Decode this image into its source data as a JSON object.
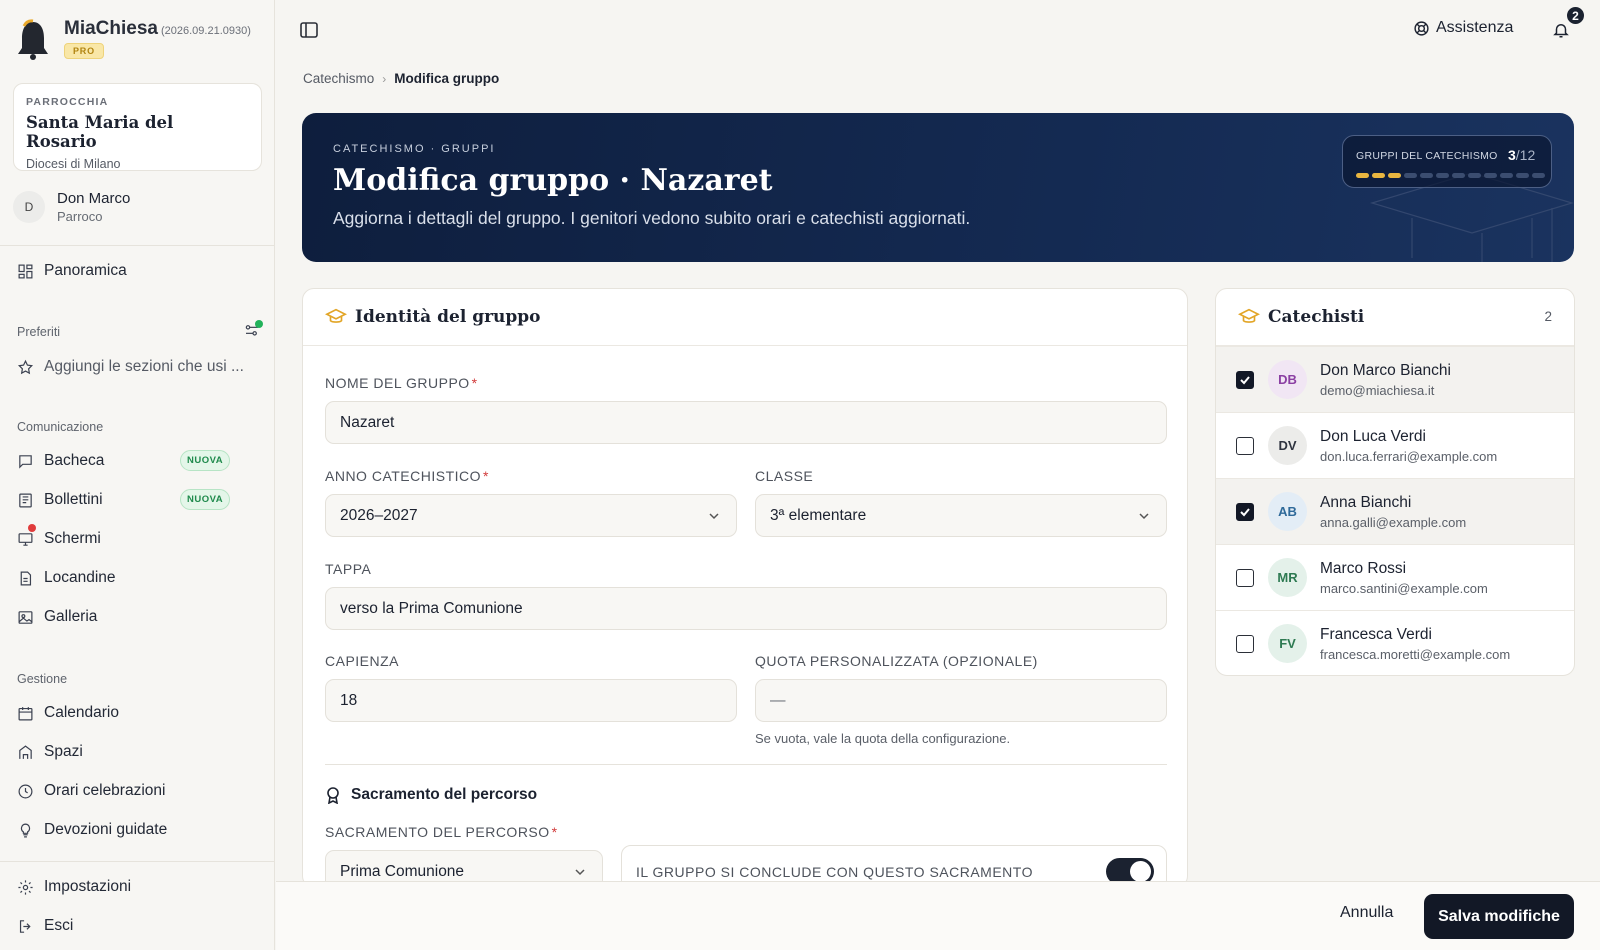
{
  "brand": {
    "name": "MiaChiesa",
    "version": "(2026.09.21.0930)",
    "badge": "PRO"
  },
  "parish": {
    "kicker": "PARROCCHIA",
    "name": "Santa Maria del Rosario",
    "diocese": "Diocesi di Milano"
  },
  "user": {
    "initial": "D",
    "name": "Don Marco",
    "role": "Parroco"
  },
  "sidebar": {
    "overview": "Panoramica",
    "favorites_title": "Preferiti",
    "favorites_add": "Aggiungi le sezioni che usi ...",
    "communication_title": "Comunicazione",
    "communication": [
      {
        "label": "Bacheca",
        "badge": "NUOVA"
      },
      {
        "label": "Bollettini",
        "badge": "NUOVA"
      },
      {
        "label": "Schermi"
      },
      {
        "label": "Locandine"
      },
      {
        "label": "Galleria"
      }
    ],
    "management_title": "Gestione",
    "management": [
      {
        "label": "Calendario"
      },
      {
        "label": "Spazi"
      },
      {
        "label": "Orari celebrazioni"
      },
      {
        "label": "Devozioni guidate"
      }
    ],
    "settings": "Impostazioni",
    "logout": "Esci"
  },
  "topbar": {
    "assist": "Assistenza",
    "notifications": "2"
  },
  "breadcrumb": {
    "parent": "Catechismo",
    "current": "Modifica gruppo"
  },
  "hero": {
    "kicker": "CATECHISMO · GRUPPI",
    "title": "Modifica gruppo · Nazaret",
    "subtitle": "Aggiorna i dettagli del gruppo. I genitori vedono subito orari e catechisti aggiornati.",
    "pill_label": "GRUPPI DEL CATECHISMO",
    "pill_current": "3",
    "pill_total": "/12",
    "progress": {
      "current": 3,
      "total": 12
    }
  },
  "form": {
    "title": "Identità del gruppo",
    "name_label": "NOME DEL GRUPPO",
    "name_value": "Nazaret",
    "year_label": "ANNO CATECHISTICO",
    "year_value": "2026–2027",
    "class_label": "CLASSE",
    "class_value": "3ª elementare",
    "stage_label": "TAPPA",
    "stage_value": "verso la Prima Comunione",
    "capacity_label": "CAPIENZA",
    "capacity_value": "18",
    "fee_label": "QUOTA PERSONALIZZATA (OPZIONALE)",
    "fee_value": "—",
    "fee_hint": "Se vuota, vale la quota della configurazione.",
    "sacrament_section": "Sacramento del percorso",
    "sacrament_label": "SACRAMENTO DEL PERCORSO",
    "sacrament_value": "Prima Comunione",
    "concludes_label": "IL GRUPPO SI CONCLUDE CON QUESTO SACRAMENTO",
    "concludes_on": true
  },
  "catechists": {
    "title": "Catechisti",
    "count": "2",
    "items": [
      {
        "initials": "DB",
        "name": "Don Marco Bianchi",
        "email": "demo@miachiesa.it",
        "checked": true,
        "bg": "#f1e6f4",
        "fg": "#8b3fa3"
      },
      {
        "initials": "DV",
        "name": "Don Luca Verdi",
        "email": "don.luca.ferrari@example.com",
        "checked": false,
        "bg": "#ececea",
        "fg": "#2f3440"
      },
      {
        "initials": "AB",
        "name": "Anna Bianchi",
        "email": "anna.galli@example.com",
        "checked": true,
        "bg": "#e3edf6",
        "fg": "#2f6a9a"
      },
      {
        "initials": "MR",
        "name": "Marco Rossi",
        "email": "marco.santini@example.com",
        "checked": false,
        "bg": "#e4f1ea",
        "fg": "#2e7a52"
      },
      {
        "initials": "FV",
        "name": "Francesca Verdi",
        "email": "francesca.moretti@example.com",
        "checked": false,
        "bg": "#e4f1ea",
        "fg": "#2e7a52"
      }
    ]
  },
  "actions": {
    "cancel": "Annulla",
    "save": "Salva modifiche"
  },
  "colors": {
    "navy": "#121826",
    "accent_gold": "#e9b640",
    "hero_bg": "#0e1e3d"
  }
}
